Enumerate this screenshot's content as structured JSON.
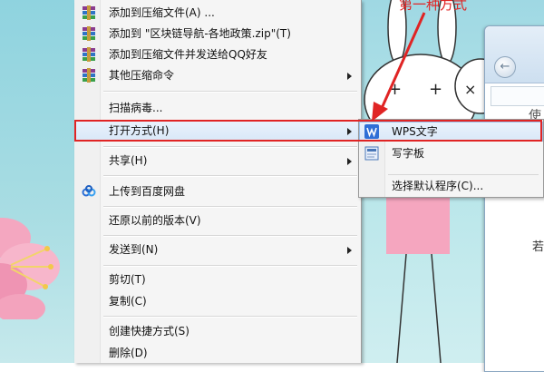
{
  "annotation": {
    "label": "第一种方式",
    "color": "#e02424"
  },
  "context_menu": {
    "items": [
      {
        "label": "添加到压缩文件(A) ...",
        "icon": "winrar-icon",
        "submenu": false
      },
      {
        "label": "添加到 \"区块链导航-各地政策.zip\"(T)",
        "icon": "winrar-icon",
        "submenu": false
      },
      {
        "label": "添加到压缩文件并发送给QQ好友",
        "icon": "winrar-icon",
        "submenu": false
      },
      {
        "label": "其他压缩命令",
        "icon": "winrar-icon",
        "submenu": true
      },
      {
        "label": "扫描病毒...",
        "icon": "",
        "submenu": false
      },
      {
        "label": "打开方式(H)",
        "icon": "",
        "submenu": true,
        "highlighted": true
      },
      {
        "label": "共享(H)",
        "icon": "",
        "submenu": true
      },
      {
        "label": "上传到百度网盘",
        "icon": "baidu-netdisk-icon",
        "submenu": false
      },
      {
        "label": "还原以前的版本(V)",
        "icon": "",
        "submenu": false
      },
      {
        "label": "发送到(N)",
        "icon": "",
        "submenu": true
      },
      {
        "label": "剪切(T)",
        "icon": "",
        "submenu": false
      },
      {
        "label": "复制(C)",
        "icon": "",
        "submenu": false
      },
      {
        "label": "创建快捷方式(S)",
        "icon": "",
        "submenu": false
      },
      {
        "label": "删除(D)",
        "icon": "",
        "submenu": false
      }
    ]
  },
  "open_with_submenu": {
    "items": [
      {
        "label": "WPS文字",
        "icon": "wps-writer-icon",
        "highlighted": true
      },
      {
        "label": "写字板",
        "icon": "wordpad-icon"
      },
      {
        "label": "选择默认程序(C)...",
        "icon": ""
      }
    ]
  },
  "background_window": {
    "char_top": "使",
    "char_mid": "若"
  },
  "colors": {
    "highlight_border": "#e02424",
    "menu_bg": "#f5f5f5",
    "selection": "#d9e8f8"
  }
}
